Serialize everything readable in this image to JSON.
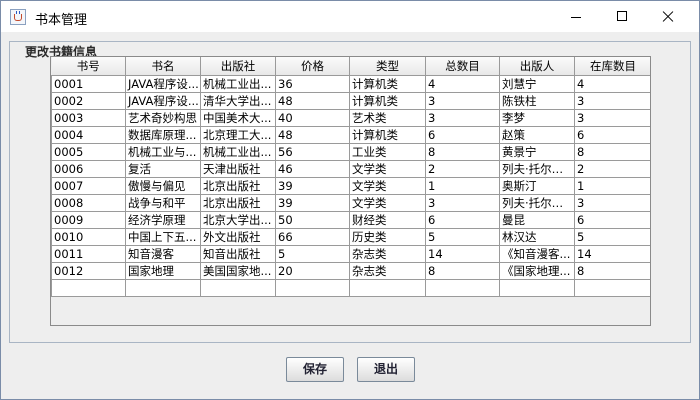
{
  "window": {
    "title": "书本管理"
  },
  "group": {
    "title": "更改书籍信息"
  },
  "table": {
    "headers": [
      "书号",
      "书名",
      "出版社",
      "价格",
      "类型",
      "总数目",
      "出版人",
      "在库数目"
    ],
    "rows": [
      [
        "0001",
        "JAVA程序设...",
        "机械工业出...",
        "36",
        "计算机类",
        "4",
        "刘慧宁",
        "4"
      ],
      [
        "0002",
        "JAVA程序设...",
        "清华大学出...",
        "48",
        "计算机类",
        "3",
        "陈铁柱",
        "3"
      ],
      [
        "0003",
        "艺术奇妙构思",
        "中国美术大...",
        "40",
        "艺术类",
        "3",
        "李梦",
        "3"
      ],
      [
        "0004",
        "数据库原理...",
        "北京理工大...",
        "48",
        "计算机类",
        "6",
        "赵策",
        "6"
      ],
      [
        "0005",
        "机械工业与...",
        "机械工业出...",
        "56",
        "工业类",
        "8",
        "黄景宁",
        "8"
      ],
      [
        "0006",
        "复活",
        "天津出版社",
        "46",
        "文学类",
        "2",
        "列夫·托尔斯...",
        "2"
      ],
      [
        "0007",
        "傲慢与偏见",
        "北京出版社",
        "39",
        "文学类",
        "1",
        "奥斯汀",
        "1"
      ],
      [
        "0008",
        "战争与和平",
        "北京出版社",
        "39",
        "文学类",
        "3",
        "列夫·托尔斯...",
        "3"
      ],
      [
        "0009",
        "经济学原理",
        "北京大学出...",
        "50",
        "财经类",
        "6",
        "曼昆",
        "6"
      ],
      [
        "0010",
        "中国上下五...",
        "外文出版社",
        "66",
        "历史类",
        "5",
        "林汉达",
        "5"
      ],
      [
        "0011",
        "知音漫客",
        "知音出版社",
        "5",
        "杂志类",
        "14",
        "《知音漫客...",
        "14"
      ],
      [
        "0012",
        "国家地理",
        "美国国家地...",
        "20",
        "杂志类",
        "8",
        "《国家地理...",
        "8"
      ],
      [
        "",
        "",
        "",
        "",
        "",
        "",
        "",
        ""
      ]
    ]
  },
  "buttons": {
    "save": "保存",
    "exit": "退出"
  },
  "icons": {
    "app": "java-cup-icon",
    "minimize": "minimize-icon",
    "maximize": "maximize-icon",
    "close": "close-icon"
  }
}
